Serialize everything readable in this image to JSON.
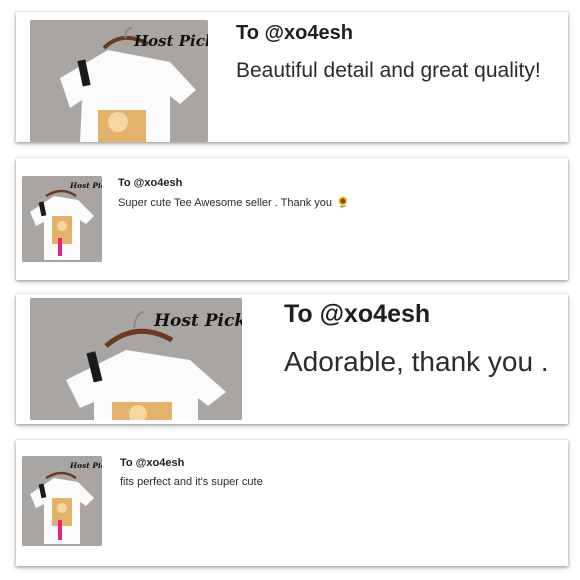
{
  "reviews": [
    {
      "to": "To @xo4esh",
      "message": "Beautiful detail and great quality!",
      "emoji": ""
    },
    {
      "to": "To @xo4esh",
      "message": "Super cute Tee Awesome seller . Thank you",
      "emoji": "🌻"
    },
    {
      "to": "To @xo4esh",
      "message": "Adorable, thank you .",
      "emoji": ""
    },
    {
      "to": "To @xo4esh",
      "message": "fits perfect and it's super cute",
      "emoji": ""
    }
  ],
  "thumb_label": "Host Pick",
  "colors": {
    "thumb_bg": "#a9a5a3",
    "shirt": "#fbfbfb",
    "strap": "#1a1a1a",
    "photo": "#e2b26a"
  }
}
